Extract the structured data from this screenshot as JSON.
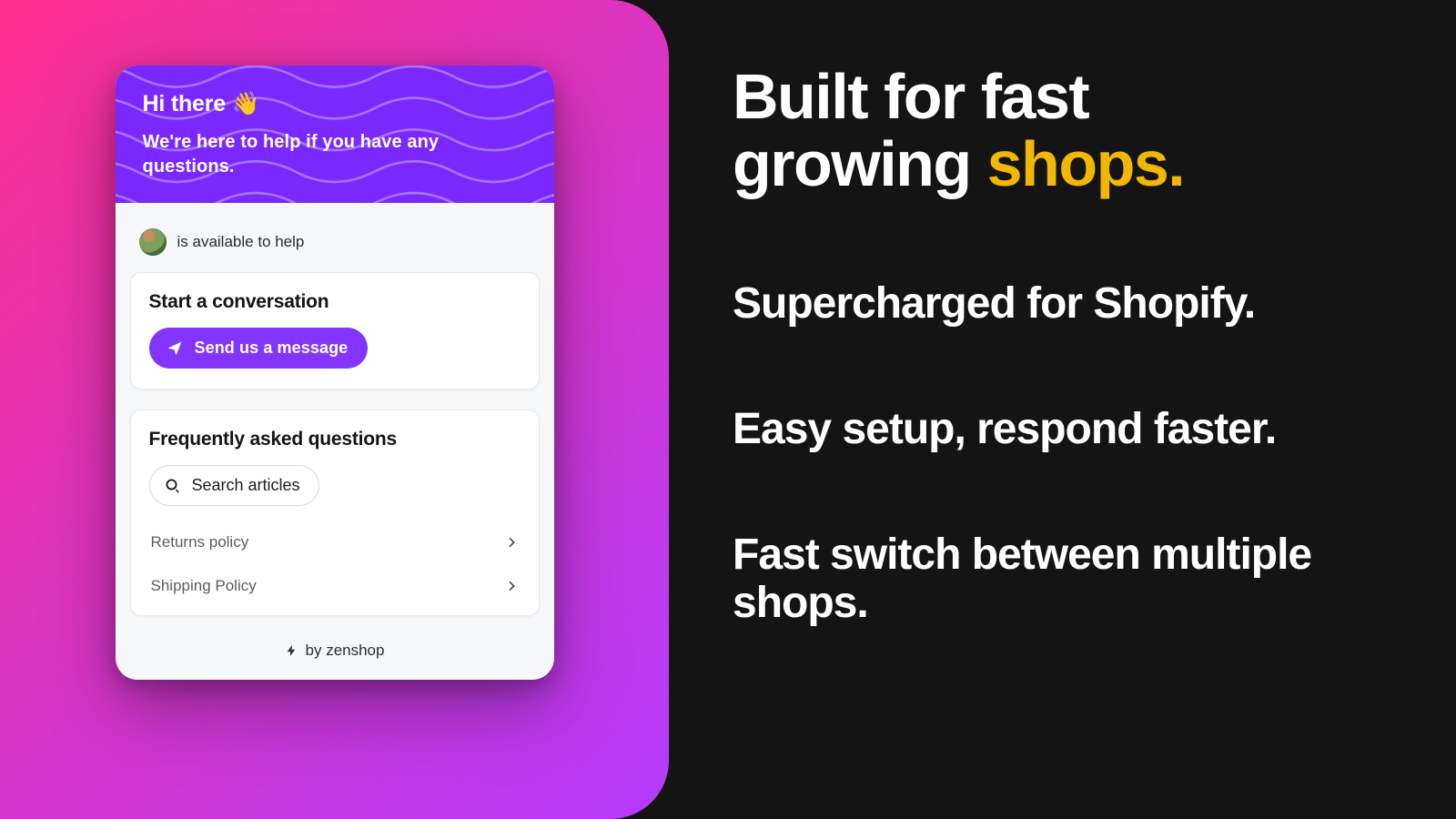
{
  "colors": {
    "accent_gold": "#f2b705",
    "widget_purple": "#7b28ff",
    "button_purple": "#8334ff",
    "gradient_from": "#ff2f8e",
    "gradient_to": "#b33bff"
  },
  "widget": {
    "header": {
      "greeting": "Hi there",
      "greeting_emoji": "👋",
      "subtext": "We're here to help if you have any questions."
    },
    "availability_text": "is available to help",
    "start_card": {
      "title": "Start a conversation",
      "button_label": "Send us a message"
    },
    "faq_card": {
      "title": "Frequently asked questions",
      "search_label": "Search articles",
      "items": [
        {
          "label": "Returns policy"
        },
        {
          "label": "Shipping Policy"
        }
      ]
    },
    "footer": {
      "label": "by zenshop"
    }
  },
  "marketing": {
    "hero_line1": "Built for fast",
    "hero_line2_pre": "growing ",
    "hero_line2_accent": "shops.",
    "features": [
      "Supercharged for Shopify.",
      "Easy setup, respond faster.",
      "Fast switch between multiple shops."
    ]
  }
}
